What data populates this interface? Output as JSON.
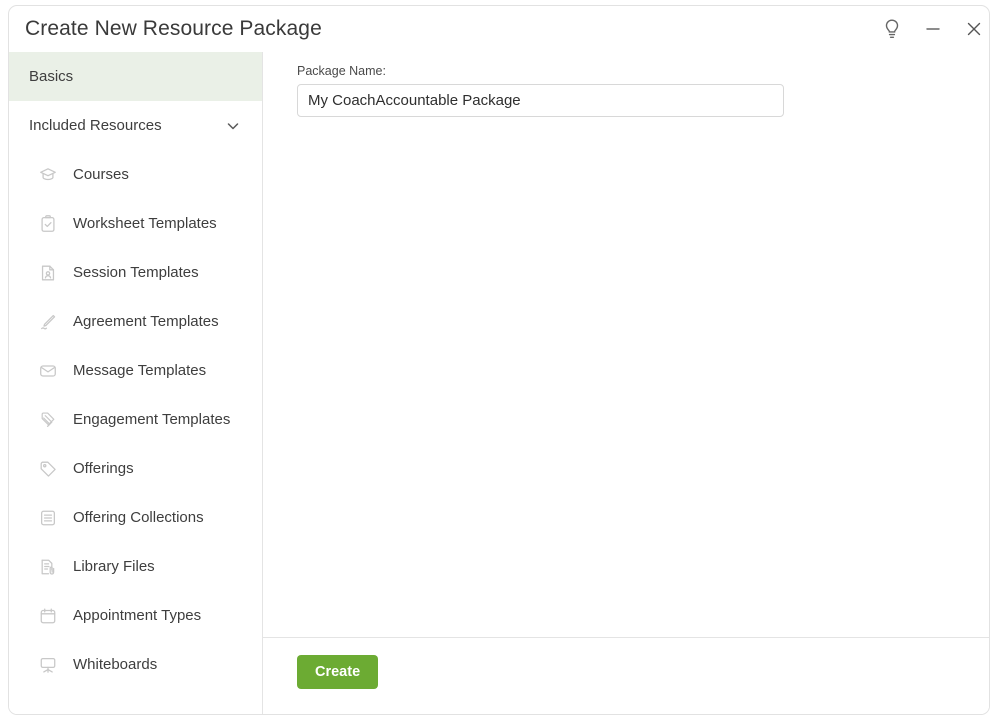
{
  "window": {
    "title": "Create New Resource Package",
    "controls": [
      {
        "name": "help-lightbulb-icon",
        "label": "Help"
      },
      {
        "name": "minimize-icon",
        "label": "Minimize"
      },
      {
        "name": "close-icon",
        "label": "Close"
      }
    ]
  },
  "sidebar": {
    "basics": {
      "label": "Basics",
      "selected": true
    },
    "group": {
      "label": "Included Resources",
      "expanded": true,
      "chevron": "chevron-down-icon"
    },
    "items": [
      {
        "label": "Courses",
        "icon": "graduation-cap-icon"
      },
      {
        "label": "Worksheet Templates",
        "icon": "clipboard-check-icon"
      },
      {
        "label": "Session Templates",
        "icon": "document-person-icon"
      },
      {
        "label": "Agreement Templates",
        "icon": "signature-pen-icon"
      },
      {
        "label": "Message Templates",
        "icon": "envelope-icon"
      },
      {
        "label": "Engagement Templates",
        "icon": "stacked-tags-icon"
      },
      {
        "label": "Offerings",
        "icon": "tag-icon"
      },
      {
        "label": "Offering Collections",
        "icon": "list-box-icon"
      },
      {
        "label": "Library Files",
        "icon": "file-attachment-icon"
      },
      {
        "label": "Appointment Types",
        "icon": "calendar-icon"
      },
      {
        "label": "Whiteboards",
        "icon": "easel-board-icon"
      }
    ]
  },
  "main": {
    "package_name_label": "Package Name:",
    "package_name_value": "My CoachAccountable Package",
    "package_name_placeholder": "Package Name"
  },
  "footer": {
    "create_label": "Create"
  },
  "colors": {
    "accent_green": "#6cab33",
    "selected_row": "#eaf0e7",
    "border": "#e4e4e4",
    "icon_grey": "#c8c8c8",
    "text": "#3e3e3e"
  }
}
